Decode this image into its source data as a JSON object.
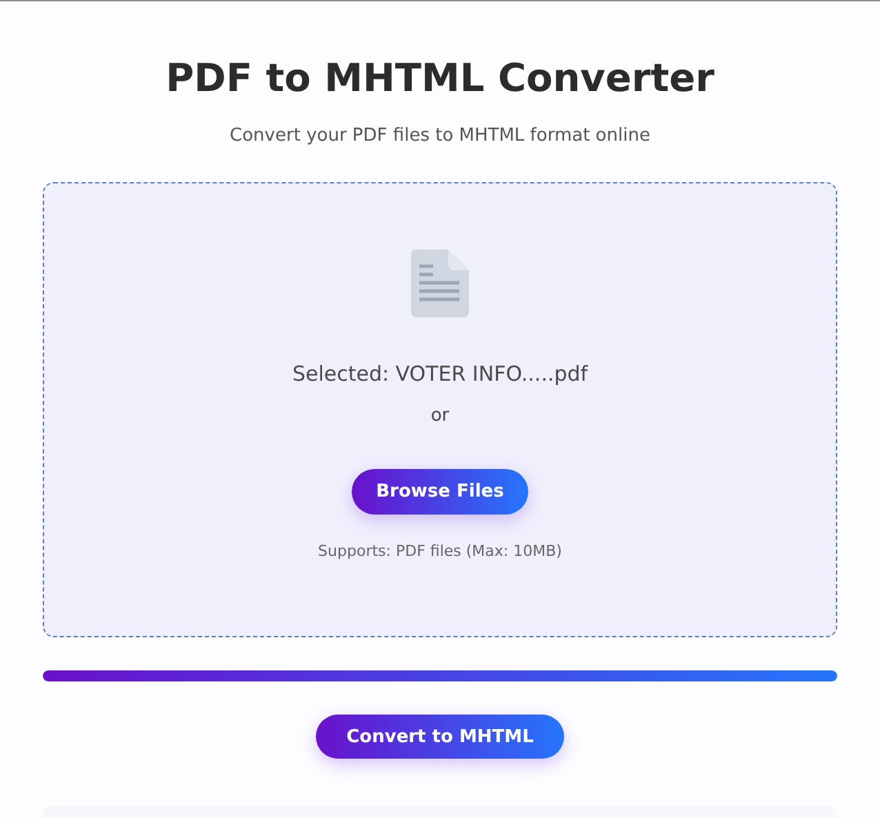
{
  "title": "PDF to MHTML Converter",
  "subtitle": "Convert your PDF files to MHTML format online",
  "upload": {
    "selected_file": "Selected: VOTER INFO.....pdf",
    "separator": "or",
    "browse_button": "Browse Files",
    "note": "Supports: PDF files (Max: 10MB)"
  },
  "progress": {
    "level": 1
  },
  "convert_button": "Convert to MHTML"
}
